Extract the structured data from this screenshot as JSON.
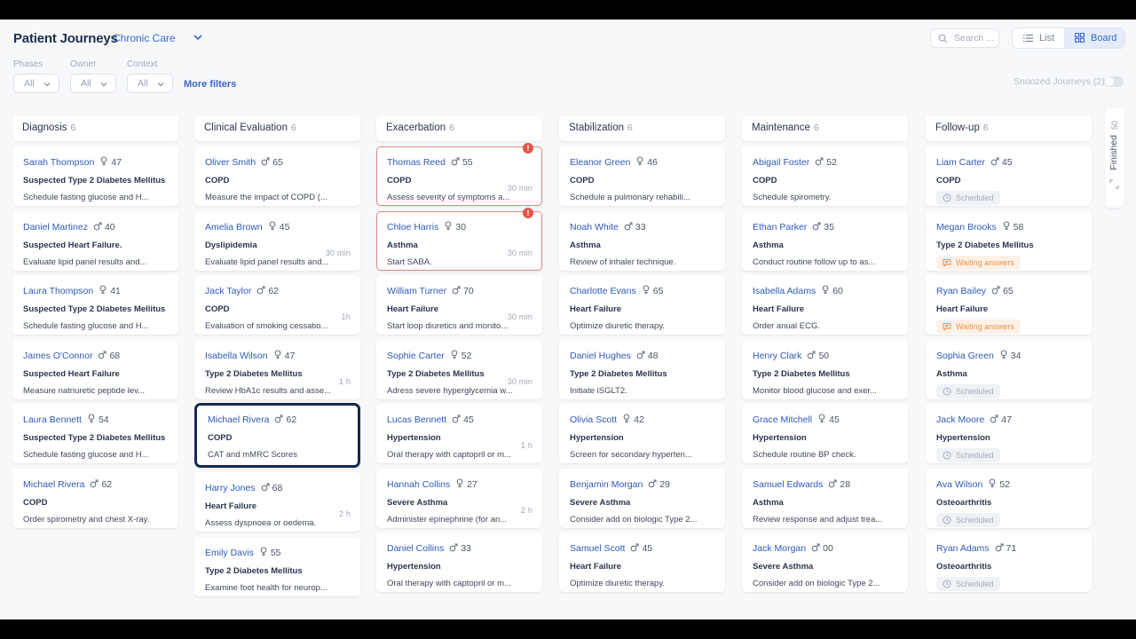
{
  "header": {
    "title": "Patient Journeys",
    "context": "Chronic Care",
    "search_placeholder": "Search ...",
    "view_list": "List",
    "view_board": "Board",
    "snoozed": "Snoozed Journeys (2)"
  },
  "filters": {
    "phases_label": "Phases",
    "phases_value": "All",
    "owner_label": "Owner",
    "owner_value": "All",
    "context_label": "Context",
    "context_value": "All",
    "more": "More filters"
  },
  "finished": {
    "label": "Finished",
    "count": "50"
  },
  "columns": [
    {
      "title": "Diagnosis",
      "count": "6",
      "cards": [
        {
          "name": "Sarah Thompson",
          "gender": "female",
          "age": "47",
          "condition": "Suspected Type 2 Diabetes Mellitus",
          "action": "Schedule fasting glucose and H..."
        },
        {
          "name": "Daniel Martinez",
          "gender": "male",
          "age": "40",
          "condition": "Suspected Heart Failure.",
          "action": "Evaluate lipid panel results and..."
        },
        {
          "name": "Laura Thompson",
          "gender": "female",
          "age": "41",
          "condition": "Suspected Type 2 Diabetes Mellitus",
          "action": "Schedule fasting glucose and H..."
        },
        {
          "name": "James O'Connor",
          "gender": "male",
          "age": "68",
          "condition": "Suspected Heart Failure",
          "action": "Measure natriuretic peptide lev..."
        },
        {
          "name": "Laura Bennett",
          "gender": "female",
          "age": "54",
          "condition": "Suspected Type 2 Diabetes Mellitus",
          "action": "Schedule fasting glucose and H..."
        },
        {
          "name": "Michael Rivera",
          "gender": "male",
          "age": "62",
          "condition": "COPD",
          "action": "Order spirometry and chest X-ray."
        }
      ]
    },
    {
      "title": "Clinical Evaluation",
      "count": "6",
      "cards": [
        {
          "name": "Oliver Smith",
          "gender": "male",
          "age": "65",
          "condition": "COPD",
          "action": "Measure the impact of COPD (..."
        },
        {
          "name": "Amelia Brown",
          "gender": "female",
          "age": "45",
          "condition": "Dyslipidemia",
          "action": "Evaluate lipid panel results and...",
          "time": "30 min"
        },
        {
          "name": "Jack Taylor",
          "gender": "male",
          "age": "62",
          "condition": "COPD",
          "action": "Evaluation of smoking cessatio...",
          "time": "1h"
        },
        {
          "name": "Isabella Wilson",
          "gender": "female",
          "age": "47",
          "condition": "Type 2 Diabetes Mellitus",
          "action": "Review HbA1c results and asse...",
          "time": "1 h"
        },
        {
          "name": "Michael Rivera",
          "gender": "male",
          "age": "62",
          "condition": "COPD",
          "action": "CAT and mMRC Scores",
          "selected": true
        },
        {
          "name": "Harry Jones",
          "gender": "male",
          "age": "68",
          "condition": "Heart Failure",
          "action": "Assess dyspnoea or oedema.",
          "time": "2 h"
        },
        {
          "name": "Emily Davis",
          "gender": "female",
          "age": "55",
          "condition": "Type 2 Diabetes Mellitus",
          "action": "Examine foot health for neurop..."
        }
      ]
    },
    {
      "title": "Exacerbation",
      "count": "6",
      "cards": [
        {
          "name": "Thomas Reed",
          "gender": "male",
          "age": "55",
          "condition": "COPD",
          "action": "Assess severity of symptoms a...",
          "time": "30 min",
          "alert": true
        },
        {
          "name": "Chloe Harris",
          "gender": "female",
          "age": "30",
          "condition": "Asthma",
          "action": "Start SABA.",
          "time": "30 min",
          "alert": true
        },
        {
          "name": "William Turner",
          "gender": "male",
          "age": "70",
          "condition": "Heart Failure",
          "action": "Start loop diuretics and monito...",
          "time": "30 min"
        },
        {
          "name": "Sophie Carter",
          "gender": "female",
          "age": "52",
          "condition": "Type 2 Diabetes Mellitus",
          "action": "Adress severe hyperglycemia w...",
          "time": "30 min"
        },
        {
          "name": "Lucas Bennett",
          "gender": "male",
          "age": "45",
          "condition": "Hypertension",
          "action": "Oral therapy with captopril or m...",
          "time": "1 h"
        },
        {
          "name": "Hannah Collins",
          "gender": "female",
          "age": "27",
          "condition": "Severe Asthma",
          "action": "Administer epinephrine (for an...",
          "time": "2 h"
        },
        {
          "name": "Daniel Collins",
          "gender": "male",
          "age": "33",
          "condition": "Hypertension",
          "action": "Oral therapy with captopril or m..."
        }
      ]
    },
    {
      "title": "Stabilization",
      "count": "6",
      "cards": [
        {
          "name": "Eleanor Green",
          "gender": "female",
          "age": "46",
          "condition": "COPD",
          "action": "Schedule a pulmonary rehabili..."
        },
        {
          "name": "Noah White",
          "gender": "male",
          "age": "33",
          "condition": "Asthma",
          "action": "Review of inhaler technique."
        },
        {
          "name": "Charlotte Evans",
          "gender": "female",
          "age": "65",
          "condition": "Heart Failure",
          "action": "Optimize diuretic therapy."
        },
        {
          "name": "Daniel Hughes",
          "gender": "male",
          "age": "48",
          "condition": "Type 2 Diabetes Mellitus",
          "action": "Initiate iSGLT2."
        },
        {
          "name": "Olivia Scott",
          "gender": "female",
          "age": "42",
          "condition": "Hypertension",
          "action": "Screen for secondary hyperten..."
        },
        {
          "name": "Benjamin Morgan",
          "gender": "male",
          "age": "29",
          "condition": "Severe Asthma",
          "action": "Consider add on biologic Type 2..."
        },
        {
          "name": "Samuel Scott",
          "gender": "male",
          "age": "45",
          "condition": "Heart Failure",
          "action": "Optimize diuretic therapy."
        }
      ]
    },
    {
      "title": "Maintenance",
      "count": "6",
      "cards": [
        {
          "name": "Abigail Foster",
          "gender": "male",
          "age": "52",
          "condition": "COPD",
          "action": "Schedule spirometry."
        },
        {
          "name": "Ethan Parker",
          "gender": "male",
          "age": "35",
          "condition": "Asthma",
          "action": "Conduct routine follow up to as..."
        },
        {
          "name": "Isabella Adams",
          "gender": "female",
          "age": "60",
          "condition": "Heart Failure",
          "action": "Order anual ECG."
        },
        {
          "name": "Henry Clark",
          "gender": "male",
          "age": "50",
          "condition": "Type 2 Diabetes Mellitus",
          "action": "Monitor blood glucose and exer..."
        },
        {
          "name": "Grace Mitchell",
          "gender": "female",
          "age": "45",
          "condition": "Hypertension",
          "action": "Schedule routine BP check."
        },
        {
          "name": "Samuel Edwards",
          "gender": "male",
          "age": "28",
          "condition": "Asthma",
          "action": "Review response and adjust trea..."
        },
        {
          "name": "Jack Morgan",
          "gender": "male",
          "age": "00",
          "condition": "Severe Asthma",
          "action": "Consider add on biologic Type 2..."
        }
      ]
    },
    {
      "title": "Follow-up",
      "count": "6",
      "cards": [
        {
          "name": "Liam Carter",
          "gender": "male",
          "age": "45",
          "condition": "COPD",
          "badge": "Scheduled",
          "badge_type": "sched"
        },
        {
          "name": "Megan Brooks",
          "gender": "female",
          "age": "58",
          "condition": "Type 2 Diabetes Mellitus",
          "badge": "Waiting answers",
          "badge_type": "wait"
        },
        {
          "name": "Ryan Bailey",
          "gender": "male",
          "age": "65",
          "condition": "Heart Failure",
          "badge": "Waiting answers",
          "badge_type": "wait"
        },
        {
          "name": "Sophia Green",
          "gender": "female",
          "age": "34",
          "condition": "Asthma",
          "badge": "Scheduled",
          "badge_type": "sched"
        },
        {
          "name": "Jack Moore",
          "gender": "male",
          "age": "47",
          "condition": "Hypertension",
          "badge": "Scheduled",
          "badge_type": "sched"
        },
        {
          "name": "Ava Wilson",
          "gender": "female",
          "age": "52",
          "condition": "Osteoarthritis",
          "badge": "Scheduled",
          "badge_type": "sched"
        },
        {
          "name": "Ryan Adams",
          "gender": "male",
          "age": "71",
          "condition": "Osteoarthritis",
          "badge": "Scheduled",
          "badge_type": "sched"
        }
      ]
    }
  ]
}
